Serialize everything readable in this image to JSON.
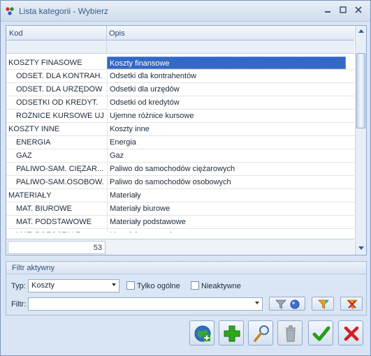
{
  "window": {
    "title": "Lista kategorii - Wybierz"
  },
  "grid": {
    "columns": [
      "Kod",
      "Opis"
    ],
    "rows": [
      {
        "kod": "KOSZTY FINASOWE",
        "opis": "Koszty finansowe",
        "indent": false,
        "selected": true
      },
      {
        "kod": "ODSET. DLA KONTRAH.",
        "opis": "Odsetki dla kontrahentów",
        "indent": true,
        "selected": false
      },
      {
        "kod": "ODSET. DLA URZĘDÓW",
        "opis": "Odsetki dla urzędów",
        "indent": true,
        "selected": false
      },
      {
        "kod": "ODSETKI OD KREDYT.",
        "opis": "Odsetki od kredytów",
        "indent": true,
        "selected": false
      },
      {
        "kod": "RÓŻNICE KURSOWE UJ...",
        "opis": "Ujemne różnice kursowe",
        "indent": true,
        "selected": false
      },
      {
        "kod": "KOSZTY INNE",
        "opis": "Koszty inne",
        "indent": false,
        "selected": false
      },
      {
        "kod": "ENERGIA",
        "opis": "Energia",
        "indent": true,
        "selected": false
      },
      {
        "kod": "GAZ",
        "opis": "Gaz",
        "indent": true,
        "selected": false
      },
      {
        "kod": "PALIWO-SAM. CIĘŻAR...",
        "opis": "Paliwo do samochodów ciężarowych",
        "indent": true,
        "selected": false
      },
      {
        "kod": "PALIWO-SAM.OSOBOW.",
        "opis": "Paliwo do samochodów osobowych",
        "indent": true,
        "selected": false
      },
      {
        "kod": "MATERIAŁY",
        "opis": "Materiały",
        "indent": false,
        "selected": false
      },
      {
        "kod": "MAT. BIUROWE",
        "opis": "Materiały biurowe",
        "indent": true,
        "selected": false
      },
      {
        "kod": "MAT. PODSTAWOWE",
        "opis": "Materiały podstawowe",
        "indent": true,
        "selected": false
      },
      {
        "kod": "MAT. POZOSTAŁE",
        "opis": "Materiały pozostałe",
        "indent": true,
        "selected": false
      }
    ],
    "count": "53",
    "scroll_position": 0.12
  },
  "filter": {
    "title": "Filtr aktywny",
    "typ_label": "Typ:",
    "typ_value": "Koszty",
    "tylko_ogolne_label": "Tylko ogólne",
    "nieaktywne_label": "Nieaktywne",
    "filtr_label": "Filtr:",
    "filtr_value": ""
  },
  "icons": {
    "app": "colored-dots-icon",
    "toolbar": [
      "funnel-icon",
      "funnel-star-icon",
      "funnel-clear-icon"
    ],
    "bottom": [
      "globe-add-icon",
      "add-icon",
      "edit-icon",
      "trash-icon",
      "confirm-icon",
      "cancel-icon"
    ]
  },
  "colors": {
    "selection": "#3468c5",
    "confirm": "#2d9a1a",
    "cancel": "#d42020",
    "add": "#2aa81a"
  }
}
